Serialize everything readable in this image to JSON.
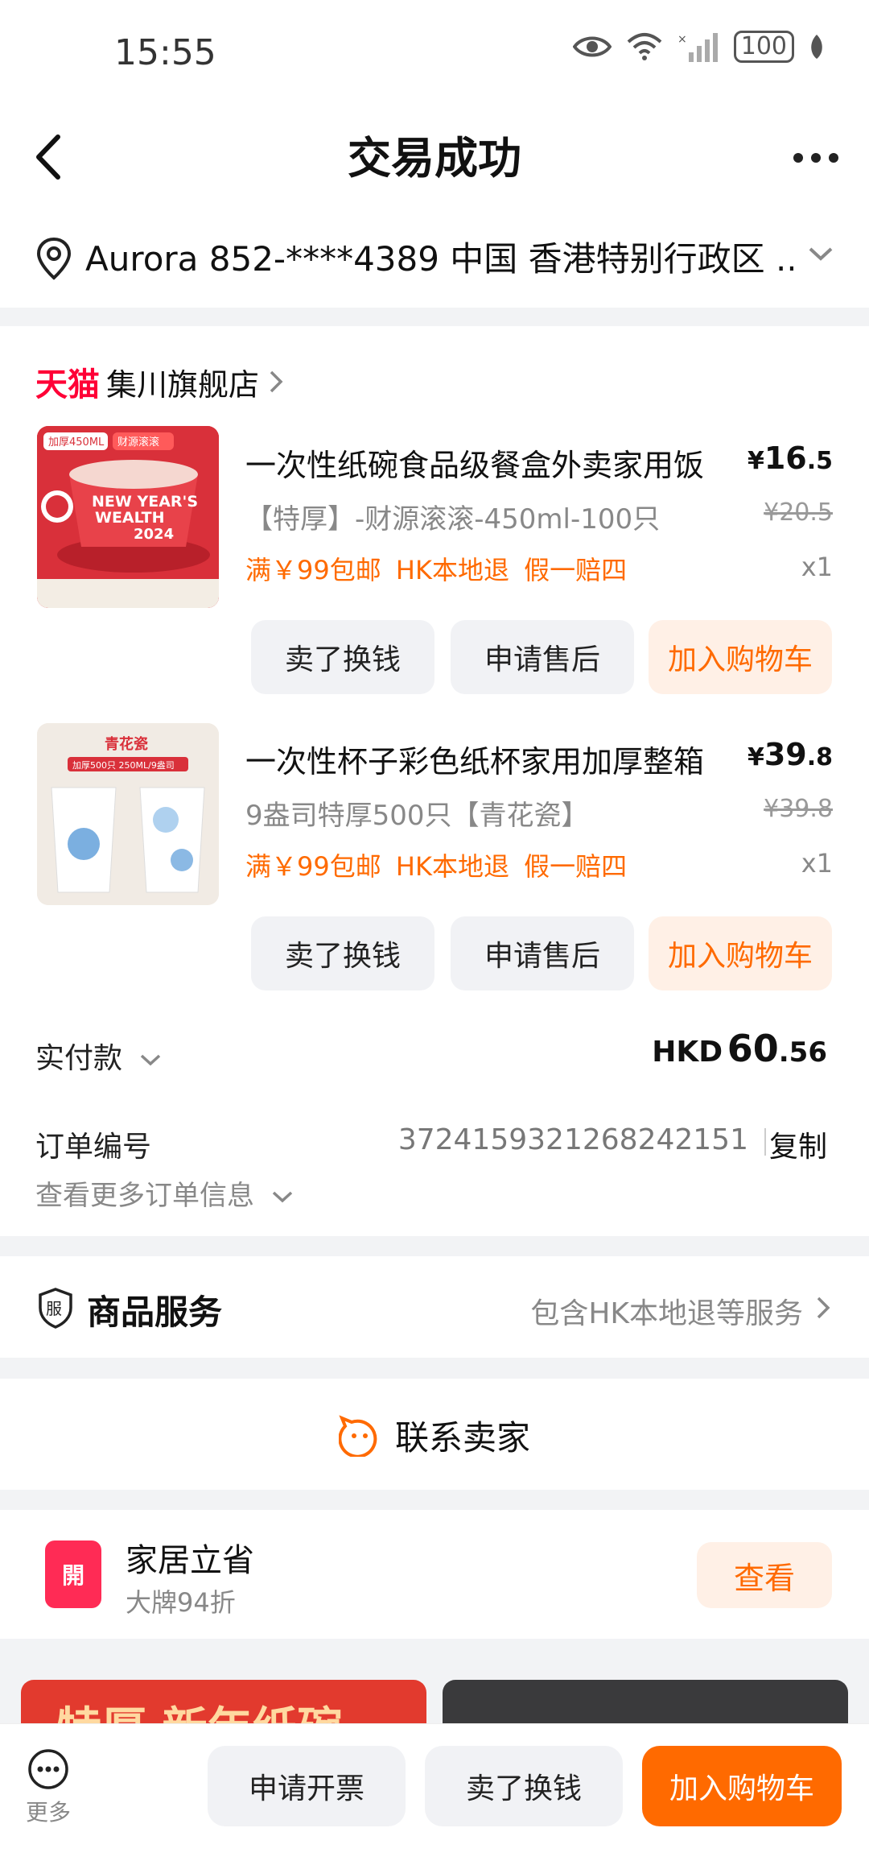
{
  "status_bar": {
    "time": "15:55",
    "battery": "100"
  },
  "nav": {
    "title": "交易成功"
  },
  "address": {
    "text": "Aurora  852-****4389  中国 香港特别行政区 ..."
  },
  "store": {
    "brand": "天猫",
    "name": "集川旗舰店"
  },
  "products": [
    {
      "title": "一次性纸碗食品级餐盒外卖家用饭",
      "sku": "【特厚】-财源滚滚-450ml-100只",
      "tags": "满￥99包邮  HK本地退  假一赔四",
      "price_currency": "¥",
      "price_int": "16",
      "price_dec": ".5",
      "original_price": "¥20.5",
      "qty": "x1",
      "image_badges": [
        "加厚450ML",
        "财源滚滚"
      ],
      "image_text": [
        "NEW YEAR'S",
        "WEALTH",
        "2024"
      ],
      "buttons": [
        "卖了换钱",
        "申请售后",
        "加入购物车"
      ]
    },
    {
      "title": "一次性杯子彩色纸杯家用加厚整箱",
      "sku": "9盎司特厚500只【青花瓷】",
      "tags": "满￥99包邮  HK本地退  假一赔四",
      "price_currency": "¥",
      "price_int": "39",
      "price_dec": ".8",
      "original_price": "¥39.8",
      "qty": "x1",
      "image_badges": [
        "青花瓷",
        "加厚500只 250ML/9盎司"
      ],
      "buttons": [
        "卖了换钱",
        "申请售后",
        "加入购物车"
      ]
    }
  ],
  "payment": {
    "label": "实付款",
    "currency": "HKD",
    "amount_int": "60",
    "amount_dec": ".56"
  },
  "order": {
    "label": "订单编号",
    "number": "3724159321268242151",
    "copy": "复制",
    "more": "查看更多订单信息"
  },
  "service": {
    "icon_text": "服",
    "title": "商品服务",
    "desc": "包含HK本地退等服务"
  },
  "contact": {
    "label": "联系卖家"
  },
  "promo": {
    "icon_text": "開",
    "title": "家居立省",
    "subtitle": "大牌94折",
    "button": "查看"
  },
  "recommend": {
    "banner_text": "特厚 新年纸碗"
  },
  "bottom_bar": {
    "more": "更多",
    "buttons": [
      "申请开票",
      "卖了换钱",
      "加入购物车"
    ]
  },
  "colors": {
    "accent": "#ff6a00",
    "tmall": "#ff0036",
    "promo": "#ff2b55"
  }
}
